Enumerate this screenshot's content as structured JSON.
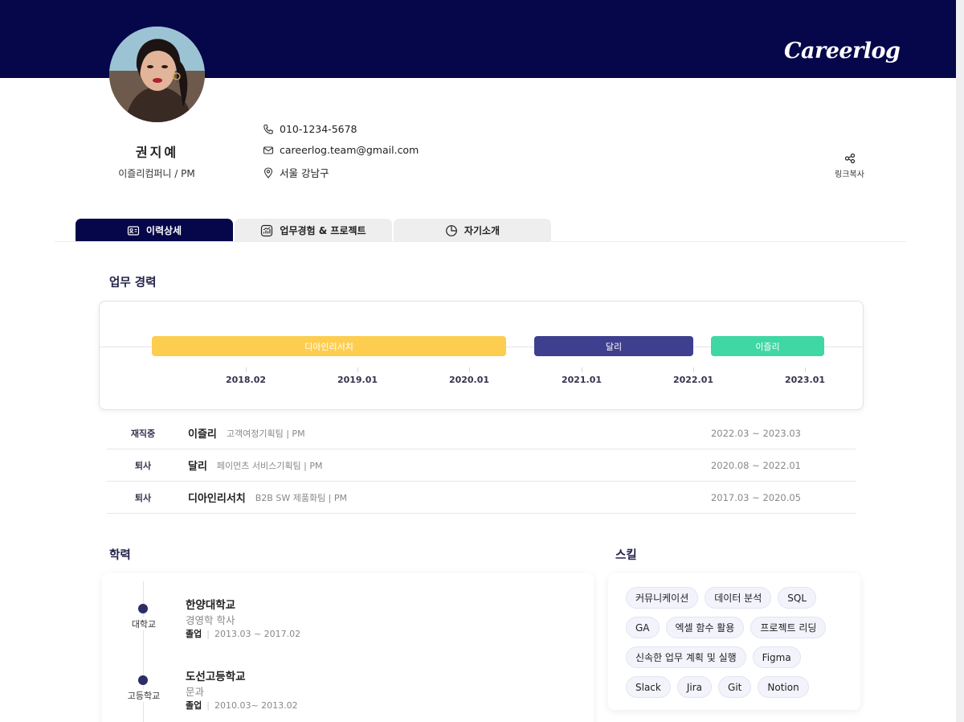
{
  "brand": "Careerlog",
  "profile": {
    "name": "권지예",
    "company": "이즐리컴퍼니 / PM",
    "phone": "010-1234-5678",
    "email": "careerlog.team@gmail.com",
    "location": "서울 강남구",
    "share_label": "링크복사"
  },
  "tabs": [
    {
      "label": "이력상세",
      "icon": "id-card-icon",
      "active": true
    },
    {
      "label": "업무경험 & 프로젝트",
      "icon": "chart-icon",
      "active": false
    },
    {
      "label": "자기소개",
      "icon": "pie-icon",
      "active": false
    }
  ],
  "career": {
    "title": "업무 경력",
    "timeline": {
      "bars": [
        {
          "label": "디아인리서치",
          "color": "#fdcd50"
        },
        {
          "label": "달리",
          "color": "#3f3f8f"
        },
        {
          "label": "이즐리",
          "color": "#3fd7a3"
        }
      ],
      "ticks": [
        "2018.02",
        "2019.01",
        "2020.01",
        "2021.01",
        "2022.01",
        "2023.01"
      ]
    },
    "rows": [
      {
        "status": "재직중",
        "company": "이즐리",
        "dept": "고객여정기획팀 | PM",
        "period": "2022.03 ~ 2023.03"
      },
      {
        "status": "퇴사",
        "company": "달리",
        "dept": "페이먼츠 서비스기획팀 | PM",
        "period": "2020.08 ~ 2022.01"
      },
      {
        "status": "퇴사",
        "company": "디아인리서치",
        "dept": "B2B SW 제품화팀 | PM",
        "period": "2017.03 ~ 2020.05"
      }
    ]
  },
  "education": {
    "title": "학력",
    "items": [
      {
        "level": "대학교",
        "school": "한양대학교",
        "major": "경영학 학사",
        "status": "졸업",
        "period": "2013.03 ~ 2017.02"
      },
      {
        "level": "고등학교",
        "school": "도선고등학교",
        "major": "문과",
        "status": "졸업",
        "period": "2010.03~ 2013.02"
      }
    ]
  },
  "skills": {
    "title": "스킬",
    "items": [
      "커뮤니케이션",
      "데이터 분석",
      "SQL",
      "GA",
      "엑셀 함수 활용",
      "프로젝트 리딩",
      "신속한 업무 계획 및 실행",
      "Figma",
      "Slack",
      "Jira",
      "Git",
      "Notion"
    ]
  }
}
